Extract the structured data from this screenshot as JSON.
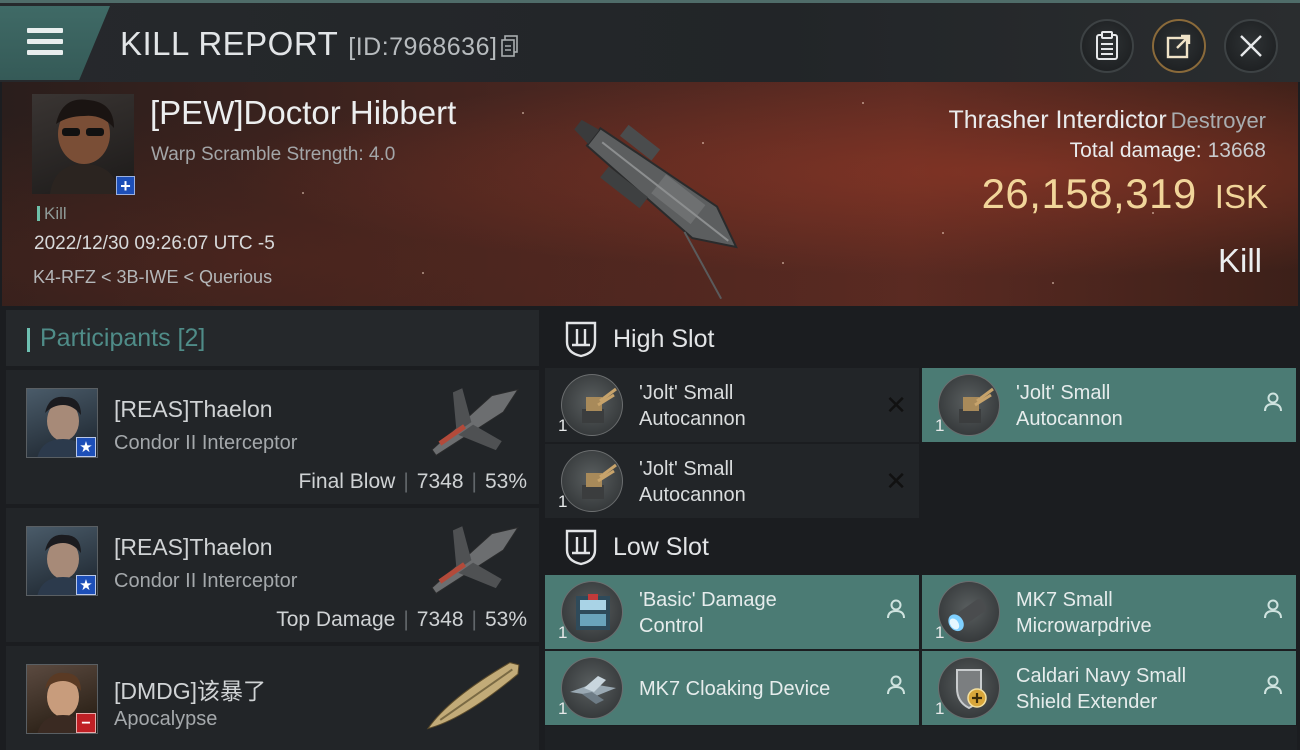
{
  "header": {
    "title": "KILL REPORT",
    "id_label": "[ID:7968636]",
    "menu_icon": "hamburger-icon",
    "actions": [
      "clipboard-icon",
      "share-icon",
      "close-icon"
    ]
  },
  "victim": {
    "name": "[PEW]Doctor Hibbert",
    "subtitle": "Warp Scramble Strength: 4.0",
    "tag": "Kill",
    "datetime": "2022/12/30 09:26:07 UTC -5",
    "location": "K4-RFZ < 3B-IWE < Querious",
    "ship_name": "Thrasher Interdictor",
    "ship_class": "Destroyer",
    "damage_label": "Total damage:",
    "damage_value": "13668",
    "isk_value": "26,158,319",
    "isk_unit": "ISK",
    "result": "Kill"
  },
  "participants": {
    "label": "Participants [2]",
    "rows": [
      {
        "name": "[REAS]Thaelon",
        "ship": "Condor II Interceptor",
        "role": "Final Blow",
        "damage": "7348",
        "percent": "53%",
        "badge": "★"
      },
      {
        "name": "[REAS]Thaelon",
        "ship": "Condor II Interceptor",
        "role": "Top Damage",
        "damage": "7348",
        "percent": "53%",
        "badge": "★"
      },
      {
        "name": "[DMDG]该暴了",
        "ship": "Apocalypse",
        "role": "",
        "damage": "",
        "percent": "",
        "badge": "−"
      }
    ]
  },
  "slots": {
    "high": {
      "label": "High Slot",
      "items": [
        {
          "name_line1": "'Jolt' Small",
          "name_line2": "Autocannon",
          "qty": "1",
          "state": "destroyed"
        },
        {
          "name_line1": "'Jolt' Small",
          "name_line2": "Autocannon",
          "qty": "1",
          "state": "dropped"
        },
        {
          "name_line1": "'Jolt' Small",
          "name_line2": "Autocannon",
          "qty": "1",
          "state": "destroyed"
        }
      ]
    },
    "low": {
      "label": "Low Slot",
      "items": [
        {
          "name_line1": "'Basic' Damage",
          "name_line2": "Control",
          "qty": "1",
          "state": "dropped"
        },
        {
          "name_line1": "MK7 Small",
          "name_line2": "Microwarpdrive",
          "qty": "1",
          "state": "dropped"
        },
        {
          "name_line1": "MK7 Cloaking Device",
          "name_line2": "",
          "qty": "1",
          "state": "dropped"
        },
        {
          "name_line1": "Caldari Navy Small",
          "name_line2": "Shield Extender",
          "qty": "1",
          "state": "dropped"
        }
      ]
    }
  },
  "colors": {
    "accent_teal": "#4b7b74",
    "isk_gold": "#f1d59a",
    "panel_dark": "#222528"
  }
}
